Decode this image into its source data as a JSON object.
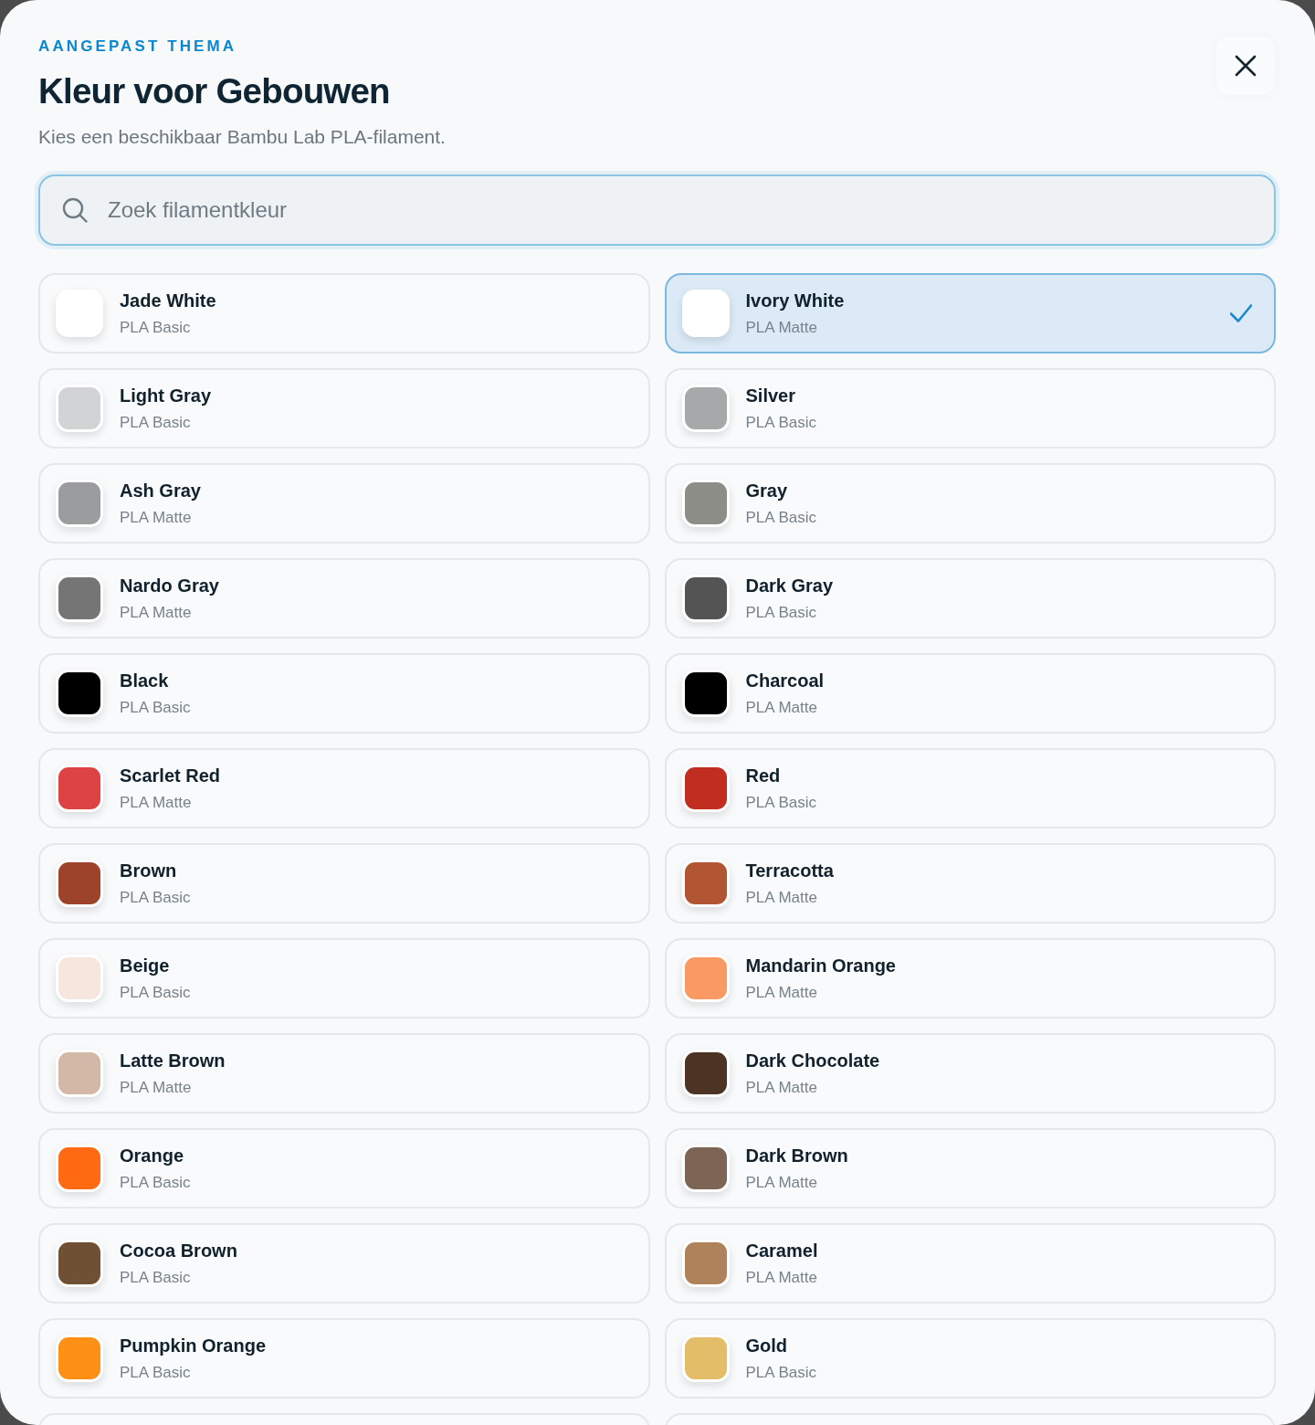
{
  "dialog": {
    "eyebrow": "AANGEPAST THEMA",
    "title": "Kleur voor Gebouwen",
    "subtitle": "Kies een beschikbaar Bambu Lab PLA-filament."
  },
  "search": {
    "placeholder": "Zoek filamentkleur"
  },
  "options": [
    {
      "name": "Jade White",
      "type": "PLA Basic",
      "color": "#ffffff",
      "selected": false
    },
    {
      "name": "Ivory White",
      "type": "PLA Matte",
      "color": "#ffffff",
      "selected": true
    },
    {
      "name": "Light Gray",
      "type": "PLA Basic",
      "color": "#d1d3d5",
      "selected": false
    },
    {
      "name": "Silver",
      "type": "PLA Basic",
      "color": "#a6a9aa",
      "selected": false
    },
    {
      "name": "Ash Gray",
      "type": "PLA Matte",
      "color": "#9b9c9e",
      "selected": false
    },
    {
      "name": "Gray",
      "type": "PLA Basic",
      "color": "#8e8e89",
      "selected": false
    },
    {
      "name": "Nardo Gray",
      "type": "PLA Matte",
      "color": "#757575",
      "selected": false
    },
    {
      "name": "Dark Gray",
      "type": "PLA Basic",
      "color": "#545454",
      "selected": false
    },
    {
      "name": "Black",
      "type": "PLA Basic",
      "color": "#000000",
      "selected": false
    },
    {
      "name": "Charcoal",
      "type": "PLA Matte",
      "color": "#000000",
      "selected": false
    },
    {
      "name": "Scarlet Red",
      "type": "PLA Matte",
      "color": "#de4343",
      "selected": false
    },
    {
      "name": "Red",
      "type": "PLA Basic",
      "color": "#c12e1f",
      "selected": false
    },
    {
      "name": "Brown",
      "type": "PLA Basic",
      "color": "#9d432c",
      "selected": false
    },
    {
      "name": "Terracotta",
      "type": "PLA Matte",
      "color": "#b15533",
      "selected": false
    },
    {
      "name": "Beige",
      "type": "PLA Basic",
      "color": "#f7e6de",
      "selected": false
    },
    {
      "name": "Mandarin Orange",
      "type": "PLA Matte",
      "color": "#f99963",
      "selected": false
    },
    {
      "name": "Latte Brown",
      "type": "PLA Matte",
      "color": "#d3b7a7",
      "selected": false
    },
    {
      "name": "Dark Chocolate",
      "type": "PLA Matte",
      "color": "#4d3324",
      "selected": false
    },
    {
      "name": "Orange",
      "type": "PLA Basic",
      "color": "#ff6a13",
      "selected": false
    },
    {
      "name": "Dark Brown",
      "type": "PLA Matte",
      "color": "#7d6556",
      "selected": false
    },
    {
      "name": "Cocoa Brown",
      "type": "PLA Basic",
      "color": "#6f5034",
      "selected": false
    },
    {
      "name": "Caramel",
      "type": "PLA Matte",
      "color": "#ae835b",
      "selected": false
    },
    {
      "name": "Pumpkin Orange",
      "type": "PLA Basic",
      "color": "#ff9016",
      "selected": false
    },
    {
      "name": "Gold",
      "type": "PLA Basic",
      "color": "#e4bd68",
      "selected": false
    }
  ]
}
